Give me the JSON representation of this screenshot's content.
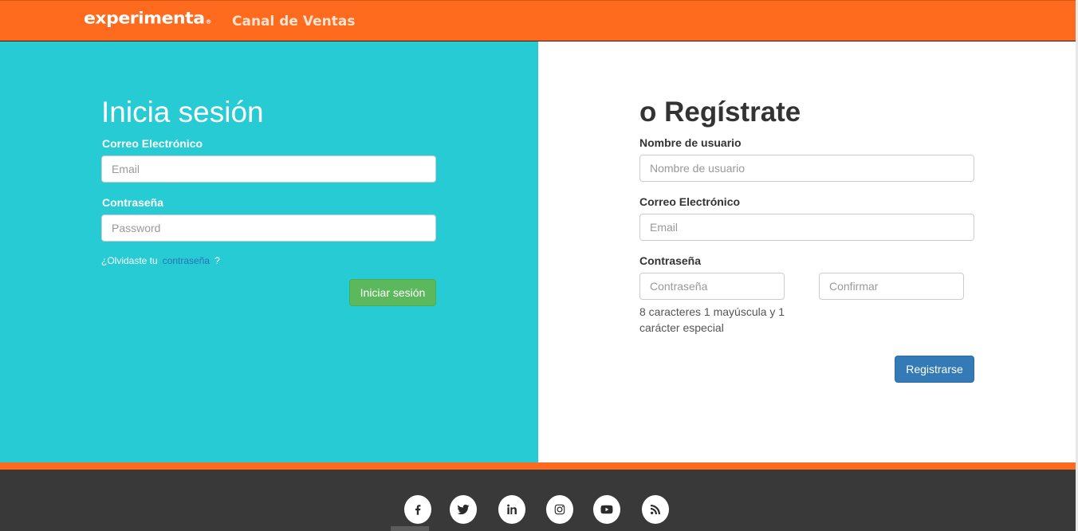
{
  "header": {
    "logo": "experimenta",
    "logo_mark": "®",
    "channel": "Canal de Ventas"
  },
  "login": {
    "title": "Inicia sesión",
    "email_label": "Correo Electrónico",
    "email_placeholder": "Email",
    "password_label": "Contraseña",
    "password_placeholder": "Password",
    "forgot_prefix": "¿Olvidaste tu",
    "forgot_link": "contraseña",
    "forgot_suffix": "?",
    "submit": "Iniciar sesión"
  },
  "register": {
    "title": "o Regístrate",
    "username_label": "Nombre de usuario",
    "username_placeholder": "Nombre de usuario",
    "email_label": "Correo Electrónico",
    "email_placeholder": "Email",
    "password_label": "Contraseña",
    "password_placeholder": "Contraseña",
    "confirm_placeholder": "Confirmar",
    "password_hint": "8 caracteres 1 mayúscula y 1 carácter especial",
    "submit": "Registrarse"
  },
  "footer": {
    "social": [
      "facebook-icon",
      "twitter-icon",
      "linkedin-icon",
      "instagram-icon",
      "youtube-icon",
      "rss-icon"
    ]
  },
  "colors": {
    "brand_orange": "#ff6b1e",
    "login_panel": "#26cbd4",
    "login_button": "#5cb85c",
    "register_button": "#337ab7",
    "footer": "#3a3939"
  }
}
